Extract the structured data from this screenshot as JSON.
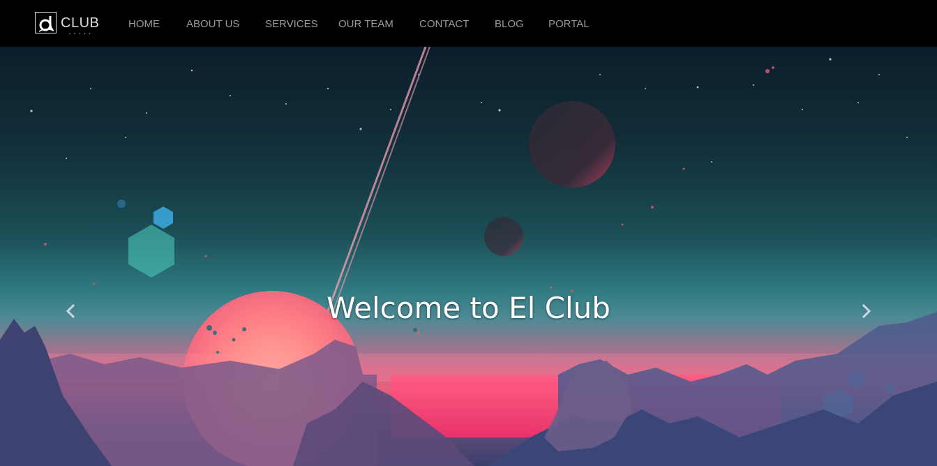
{
  "brand": {
    "logo_text": "CLUB",
    "logo_dots": "• • • • •"
  },
  "nav": {
    "items": [
      {
        "label": "HOME"
      },
      {
        "label": "ABOUT US"
      },
      {
        "label": "SERVICES"
      },
      {
        "label": "OUR TEAM"
      },
      {
        "label": "CONTACT"
      },
      {
        "label": "BLOG"
      },
      {
        "label": "PORTAL"
      }
    ]
  },
  "hero": {
    "title": "Welcome to El Club",
    "prev_icon": "chevron-left-icon",
    "next_icon": "chevron-right-icon"
  },
  "colors": {
    "navbar": "#000000",
    "nav_text": "#9a9a9a",
    "hero_title": "#ffffff"
  }
}
